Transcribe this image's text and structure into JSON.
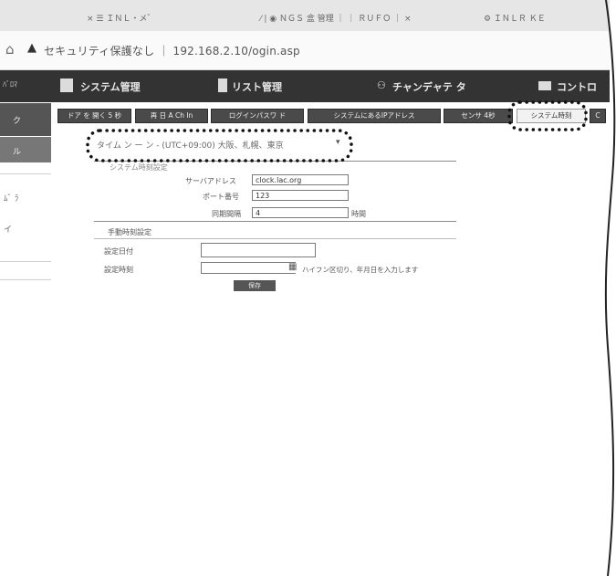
{
  "browser": {
    "tabs": [
      {
        "label": "×  ☰  ＩＮＬ・メ゛"
      },
      {
        "label": "⁄  |  ◉  ＮＧＳ 盒 管理 ｜ ｜ ＲＵＦＯ ｜ ×"
      },
      {
        "label": "⚙  ＩＮＬＲ ＫＥ"
      }
    ],
    "address": "セキュリティ保護なし ｜ 192.168.2.10/ogin.asp"
  },
  "nav": {
    "items": [
      {
        "label": "システム管理"
      },
      {
        "label": "リスト管理"
      },
      {
        "label": "チャンデャテ タ"
      },
      {
        "label": "コントロ"
      }
    ],
    "left_fragment": "ﾊﾞﾛﾏ"
  },
  "sidebar": {
    "items": [
      {
        "label": "ク"
      },
      {
        "label": "ル"
      },
      {
        "label": "ﾑﾞ ﾗ"
      },
      {
        "label": "イ"
      }
    ]
  },
  "tabs": [
    {
      "label": "ドア を 開く 5 秒"
    },
    {
      "label": "再 日 A Ch In"
    },
    {
      "label": "ログインパスワ ド"
    },
    {
      "label": "システムにあるIPアドレス"
    },
    {
      "label": "センサ 4秒"
    },
    {
      "label": "システム時刻"
    },
    {
      "label": "C"
    }
  ],
  "form": {
    "title": "タイム ン ー ン - (UTC+09:00) 大阪、札幌、東京 ",
    "section1": "システム時刻設定",
    "server_label": "サーバアドレス",
    "server_value": "clock.lac.org",
    "port_label": "ポート番号",
    "port_value": "123",
    "interval_label": "同期間隔",
    "interval_value": "4",
    "interval_unit": "時間",
    "section2": "手動時刻設定",
    "date_label": "設定日付",
    "time_label": "設定時刻",
    "time_note": "ハイフン区切り、年月日を入力します",
    "save": "保存"
  }
}
